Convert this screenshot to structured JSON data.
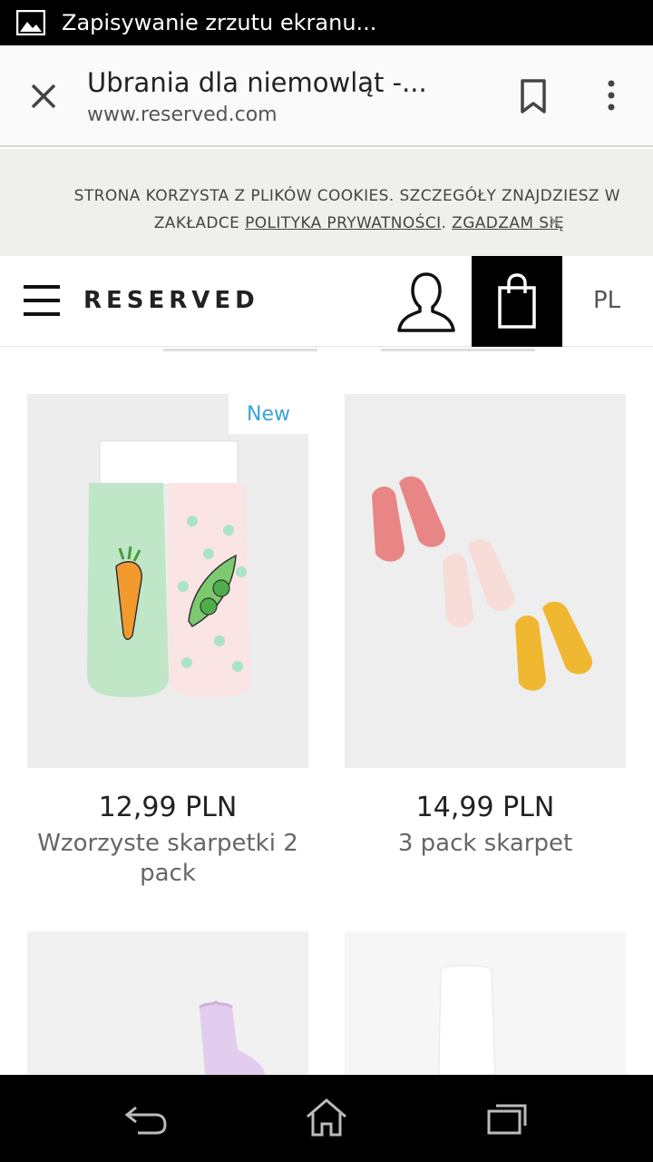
{
  "status_bar": {
    "text": "Zapisywanie zrzutu ekranu...",
    "icon": "image-icon"
  },
  "browser": {
    "title": "Ubrania dla niemowląt -...",
    "url": "www.reserved.com",
    "close_icon": "close-icon",
    "bookmark_icon": "bookmark-icon",
    "menu_icon": "more-vert-icon"
  },
  "cookie_banner": {
    "line1": "STRONA KORZYSTA Z PLIKÓW COOKIES. SZCZEGÓŁY ZNAJDZIESZ W",
    "line2_prefix": "ZAKŁADCE ",
    "policy_link": "POLITYKA PRYWATNOŚCI",
    "separator": ". ",
    "accept_link": "ZGADZAM SIĘ",
    "close_label": "✕"
  },
  "header": {
    "logo": "RESERVED",
    "language": "PL",
    "menu_icon": "hamburger-icon",
    "account_icon": "user-icon",
    "cart_icon": "shopping-bag-icon"
  },
  "products": [
    {
      "badge": "New",
      "price": "12,99 PLN",
      "name": "Wzorzyste skarpetki 2 pack",
      "image": "socks-carrot-peas"
    },
    {
      "badge": "",
      "price": "14,99 PLN",
      "name": "3 pack skarpet",
      "image": "socks-3-pack-birds"
    },
    {
      "image": "socks-lilac-frill"
    },
    {
      "image": "white-tights"
    }
  ],
  "nav": {
    "back_icon": "back-icon",
    "home_icon": "home-icon",
    "recents_icon": "recent-apps-icon"
  },
  "colors": {
    "accent_new": "#3aa3d8",
    "cart_bg": "#000000",
    "banner_bg": "#efefed"
  }
}
